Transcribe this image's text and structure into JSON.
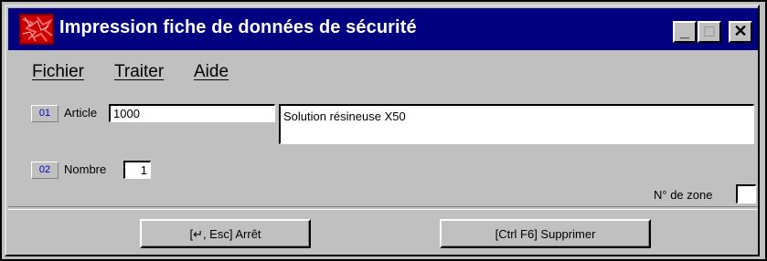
{
  "window": {
    "title": "Impression fiche de données de sécurité",
    "minimize_glyph": "_",
    "maximize_glyph": "□",
    "close_glyph": "✕",
    "app_icon": "red-document-icon"
  },
  "menu": {
    "items": [
      {
        "label": "Fichier"
      },
      {
        "label": "Traiter"
      },
      {
        "label": "Aide"
      }
    ]
  },
  "form": {
    "article": {
      "zone": "01",
      "label": "Article",
      "value": "1000",
      "description": "Solution résineuse X50"
    },
    "nombre": {
      "zone": "02",
      "label": "Nombre",
      "value": "1"
    },
    "zone_no": {
      "label": "N° de zone",
      "value": ""
    }
  },
  "buttons": {
    "stop": "[↵, Esc] Arrêt",
    "delete": "[Ctrl F6] Supprimer"
  },
  "colors": {
    "titlebar": "#000080",
    "face": "#c0c0c0",
    "zone_text": "#0000c0",
    "icon_red": "#cc0000"
  }
}
